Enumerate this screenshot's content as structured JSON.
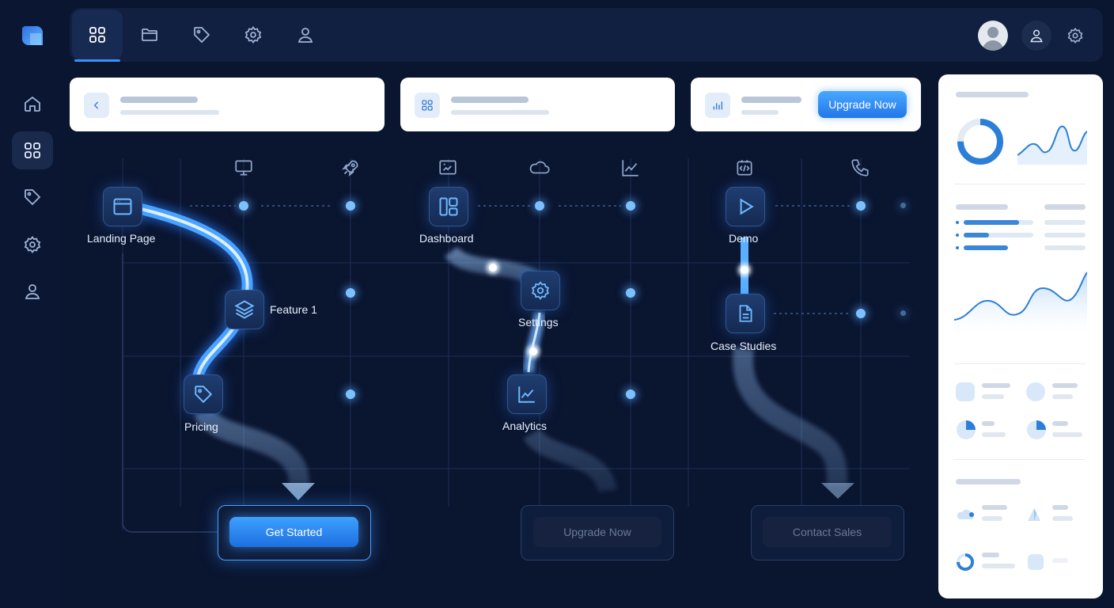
{
  "topbar": {
    "nav_icons": [
      "grid-icon",
      "folder-icon",
      "tag-icon",
      "gear-icon",
      "user-icon"
    ],
    "right_icons": [
      "avatar",
      "user-icon",
      "gear-icon"
    ]
  },
  "sidebar": {
    "icons": [
      "home-icon",
      "grid-icon",
      "tag-icon",
      "gear-icon",
      "user-icon"
    ]
  },
  "cards": {
    "upgrade_label": "Upgrade Now"
  },
  "flow": {
    "column_icons": [
      "monitor-icon",
      "rocket-icon",
      "chart-board-icon",
      "cloud-icon",
      "trend-icon",
      "code-icon",
      "phone-icon"
    ],
    "nodes": {
      "landing_page": "Landing Page",
      "feature_1": "Feature 1",
      "pricing": "Pricing",
      "dashboard": "Dashboard",
      "settings": "Settings",
      "analytics": "Analytics",
      "demo": "Demo",
      "case_studies": "Case Studies"
    },
    "buttons": {
      "get_started": "Get Started",
      "upgrade_now": "Upgrade Now",
      "contact_sales": "Contact Sales"
    }
  },
  "colors": {
    "background": "#0a1530",
    "accent": "#3d8ff5",
    "glow": "#7cc1ff",
    "panel": "#ffffff"
  }
}
